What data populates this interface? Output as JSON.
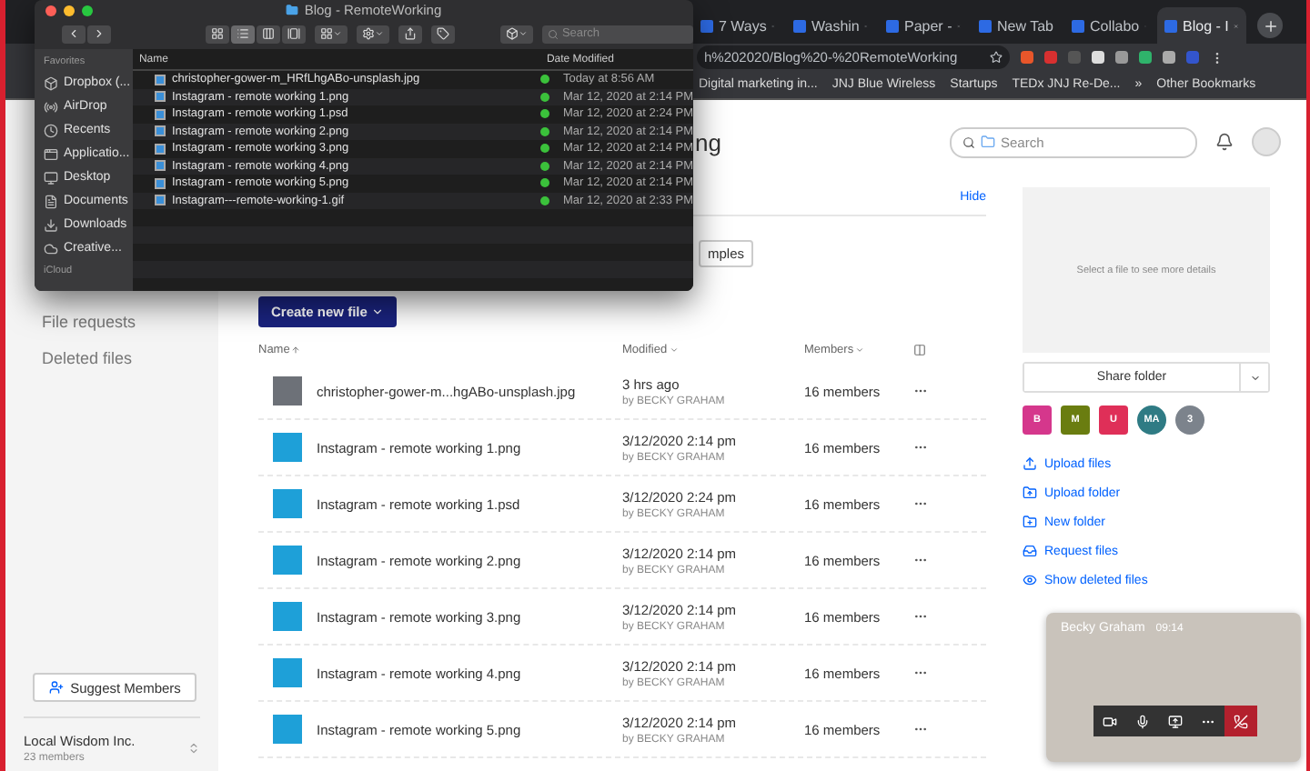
{
  "browser": {
    "tabs": [
      {
        "label": "7 Ways",
        "selected": false
      },
      {
        "label": "Washin",
        "selected": false
      },
      {
        "label": "Paper -",
        "selected": false
      },
      {
        "label": "New Tab",
        "selected": false
      },
      {
        "label": "Collabo",
        "selected": false
      },
      {
        "label": "Blog - I",
        "selected": true
      }
    ],
    "url": "h%202020/Blog%20-%20RemoteWorking",
    "bookmarks": [
      "Digital marketing in...",
      "JNJ Blue Wireless",
      "Startups",
      "TEDx JNJ Re-De...",
      "»",
      "Other Bookmarks"
    ]
  },
  "finder": {
    "title": "Blog - RemoteWorking",
    "search_placeholder": "Search",
    "views": [
      {
        "selected": false
      },
      {
        "selected": true
      },
      {
        "selected": false
      },
      {
        "selected": false
      }
    ],
    "sidebar_heading": "Favorites",
    "sidebar_items": [
      "Dropbox (...",
      "AirDrop",
      "Recents",
      "Applicatio...",
      "Desktop",
      "Documents",
      "Downloads",
      "Creative..."
    ],
    "sidebar_footer": "iCloud",
    "columns": [
      "Name",
      "Date Modified"
    ],
    "files": [
      {
        "name": "christopher-gower-m_HRfLhgABo-unsplash.jpg",
        "modified": "Today at 8:56 AM"
      },
      {
        "name": "Instagram - remote working 1.png",
        "modified": "Mar 12, 2020 at 2:14 PM"
      },
      {
        "name": "Instagram - remote working 1.psd",
        "modified": "Mar 12, 2020 at 2:24 PM"
      },
      {
        "name": "Instagram - remote working 2.png",
        "modified": "Mar 12, 2020 at 2:14 PM"
      },
      {
        "name": "Instagram - remote working 3.png",
        "modified": "Mar 12, 2020 at 2:14 PM"
      },
      {
        "name": "Instagram - remote working 4.png",
        "modified": "Mar 12, 2020 at 2:14 PM"
      },
      {
        "name": "Instagram - remote working 5.png",
        "modified": "Mar 12, 2020 at 2:14 PM"
      },
      {
        "name": "Instagram---remote-working-1.gif",
        "modified": "Mar 12, 2020 at 2:33 PM"
      }
    ]
  },
  "sidebar": {
    "links": [
      "File requests",
      "Deleted files"
    ],
    "suggest_button": "Suggest Members",
    "team_name": "Local Wisdom Inc.",
    "team_members": "23 members"
  },
  "header": {
    "title": "ng",
    "search_placeholder": "Search"
  },
  "main": {
    "hide_link": "Hide",
    "templates_button": "mples",
    "create_button": "Create new file",
    "columns": [
      "Name",
      "Modified",
      "Members"
    ],
    "rows": [
      {
        "kind": "photo",
        "name": "christopher-gower-m...hgABo-unsplash.jpg",
        "modified": "3 hrs ago",
        "by": "by BECKY GRAHAM",
        "members": "16 members"
      },
      {
        "kind": "image",
        "name": "Instagram - remote working 1.png",
        "modified": "3/12/2020 2:14 pm",
        "by": "by BECKY GRAHAM",
        "members": "16 members"
      },
      {
        "kind": "image",
        "name": "Instagram - remote working 1.psd",
        "modified": "3/12/2020 2:24 pm",
        "by": "by BECKY GRAHAM",
        "members": "16 members"
      },
      {
        "kind": "image",
        "name": "Instagram - remote working 2.png",
        "modified": "3/12/2020 2:14 pm",
        "by": "by BECKY GRAHAM",
        "members": "16 members"
      },
      {
        "kind": "image",
        "name": "Instagram - remote working 3.png",
        "modified": "3/12/2020 2:14 pm",
        "by": "by BECKY GRAHAM",
        "members": "16 members"
      },
      {
        "kind": "image",
        "name": "Instagram - remote working 4.png",
        "modified": "3/12/2020 2:14 pm",
        "by": "by BECKY GRAHAM",
        "members": "16 members"
      },
      {
        "kind": "image",
        "name": "Instagram - remote working 5.png",
        "modified": "3/12/2020 2:14 pm",
        "by": "by BECKY GRAHAM",
        "members": "16 members"
      }
    ]
  },
  "details": {
    "placeholder": "Select a file to see more details",
    "share_button": "Share folder",
    "members": [
      {
        "initials": "B",
        "kind": "square",
        "color": "#d5378c"
      },
      {
        "initials": "M",
        "kind": "square",
        "color": "#6a7d10"
      },
      {
        "initials": "U",
        "kind": "square",
        "color": "#df2f58"
      },
      {
        "initials": "MA",
        "kind": "circle",
        "color": "#2f7b84"
      },
      {
        "initials": "3",
        "kind": "circle",
        "color": "#7c838c"
      }
    ],
    "actions": [
      "Upload files",
      "Upload folder",
      "New folder",
      "Request files",
      "Show deleted files"
    ]
  },
  "call": {
    "name": "Becky Graham",
    "time": "09:14"
  }
}
